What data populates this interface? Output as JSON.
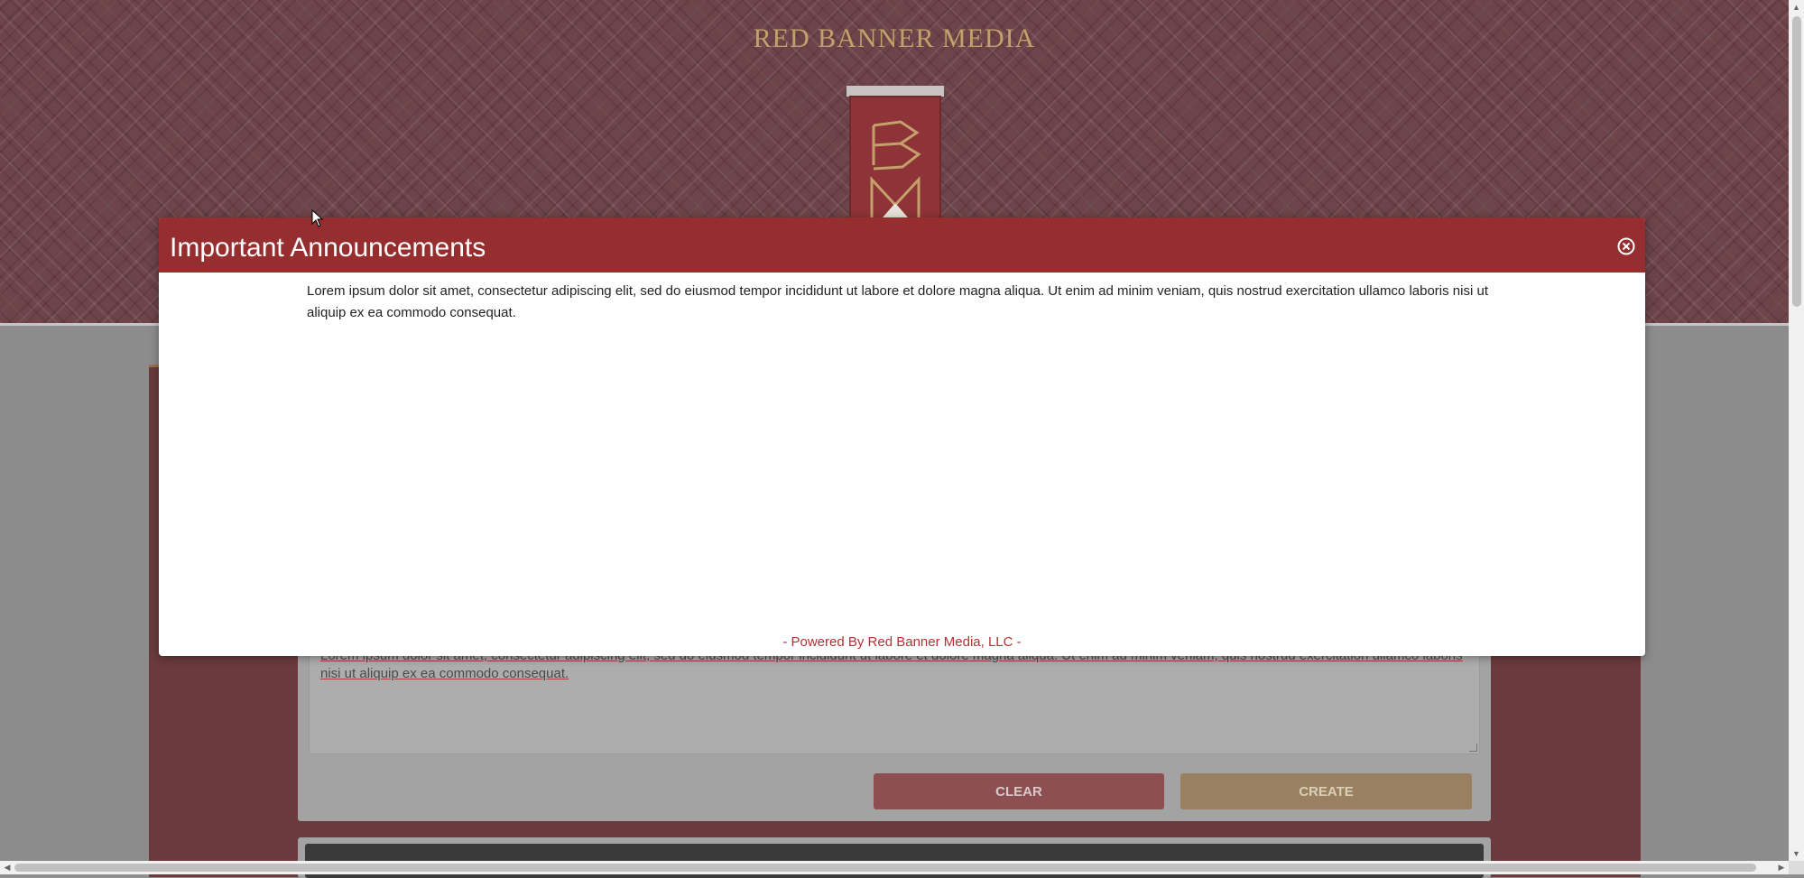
{
  "site": {
    "brand": "RED BANNER MEDIA"
  },
  "form": {
    "description_text": "Lorem ipsum dolor sit amet, consectetur adipiscing elit, sed do eiusmod tempor incididunt ut labore et dolore magna aliqua. Ut enim ad minim veniam, quis nostrud exercitation ullamco laboris nisi ut aliquip ex ea commodo consequat.",
    "clear_label": "CLEAR",
    "create_label": "CREATE"
  },
  "modal": {
    "title": "Important Announcements",
    "body": "Lorem ipsum dolor sit amet, consectetur adipiscing elit, sed do eiusmod tempor incididunt ut labore et dolore magna aliqua. Ut enim ad minim veniam, quis nostrud exercitation ullamco laboris nisi ut aliquip ex ea commodo consequat.",
    "footer": "- Powered By Red Banner Media, LLC -",
    "close_icon": "close-circle-icon"
  },
  "colors": {
    "brand_gold": "#c4a06a",
    "modal_header": "#962d2e",
    "footer_red": "#b23234"
  }
}
